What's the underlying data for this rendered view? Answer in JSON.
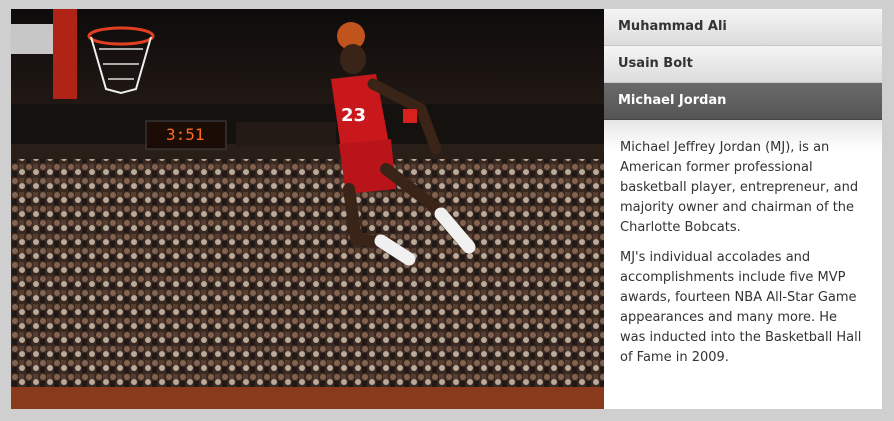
{
  "accordion": {
    "items": [
      {
        "label": "Muhammad Ali"
      },
      {
        "label": "Usain Bolt"
      },
      {
        "label": "Michael Jordan"
      }
    ],
    "active_index": 2,
    "content": {
      "paragraph_1": "Michael Jeffrey Jordan (MJ), is an American former professional basketball player, entrepreneur, and majority owner and chairman of the Charlotte Bobcats.",
      "paragraph_2": "MJ's individual accolades and accomplishments include five MVP awards, fourteen NBA All-Star Game appearances and many more. He was inducted into the Basketball Hall of Fame in 2009."
    }
  },
  "photo": {
    "scoreboard_text": "3:51",
    "jersey_number": "23"
  }
}
